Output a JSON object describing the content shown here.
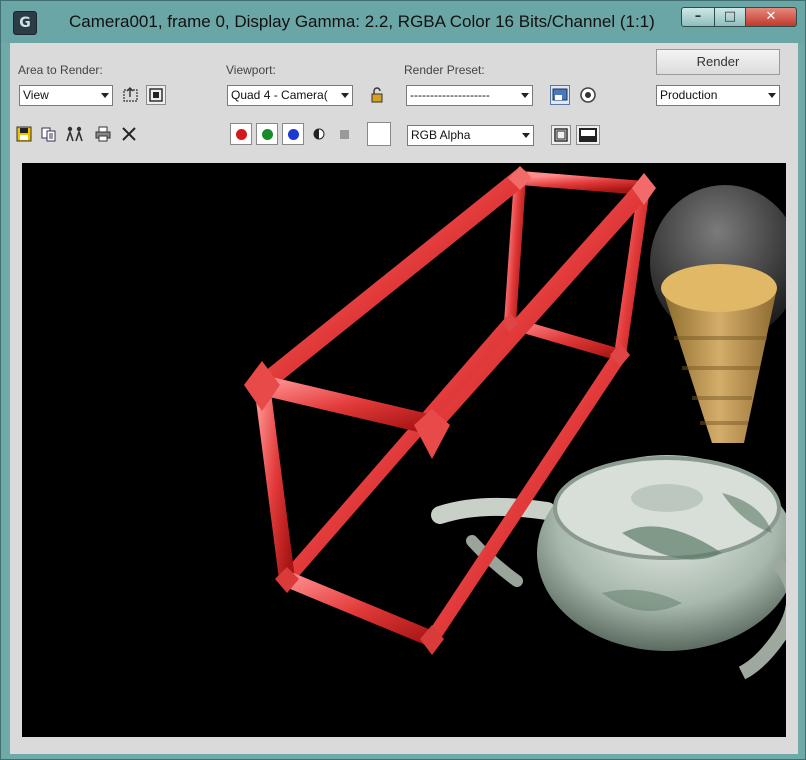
{
  "window": {
    "title": "Camera001, frame 0, Display Gamma: 2.2, RGBA Color 16 Bits/Channel (1:1)",
    "app_icon_glyph": "G"
  },
  "toolbar": {
    "area_label": "Area to Render:",
    "area_value": "View",
    "viewport_label": "Viewport:",
    "viewport_value": "Quad 4 - Camera(",
    "preset_label": "Render Preset:",
    "preset_value": "--------------------",
    "render_label": "Render",
    "mode_value": "Production",
    "channel_value": "RGB Alpha"
  },
  "colors": {
    "red_channel": "#d11a1a",
    "green_channel": "#1a8a2a",
    "blue_channel": "#1a3ad1",
    "viewport_bg": "#000000"
  },
  "icons": [
    "edit-region-icon",
    "auto-region-icon",
    "lock-icon",
    "environment-icon",
    "render-setup-icon",
    "save-icon",
    "copy-icon",
    "clone-icon",
    "print-icon",
    "clear-icon",
    "mono-icon",
    "alpha-icon",
    "display-toggle-icon",
    "overlay-icon"
  ]
}
